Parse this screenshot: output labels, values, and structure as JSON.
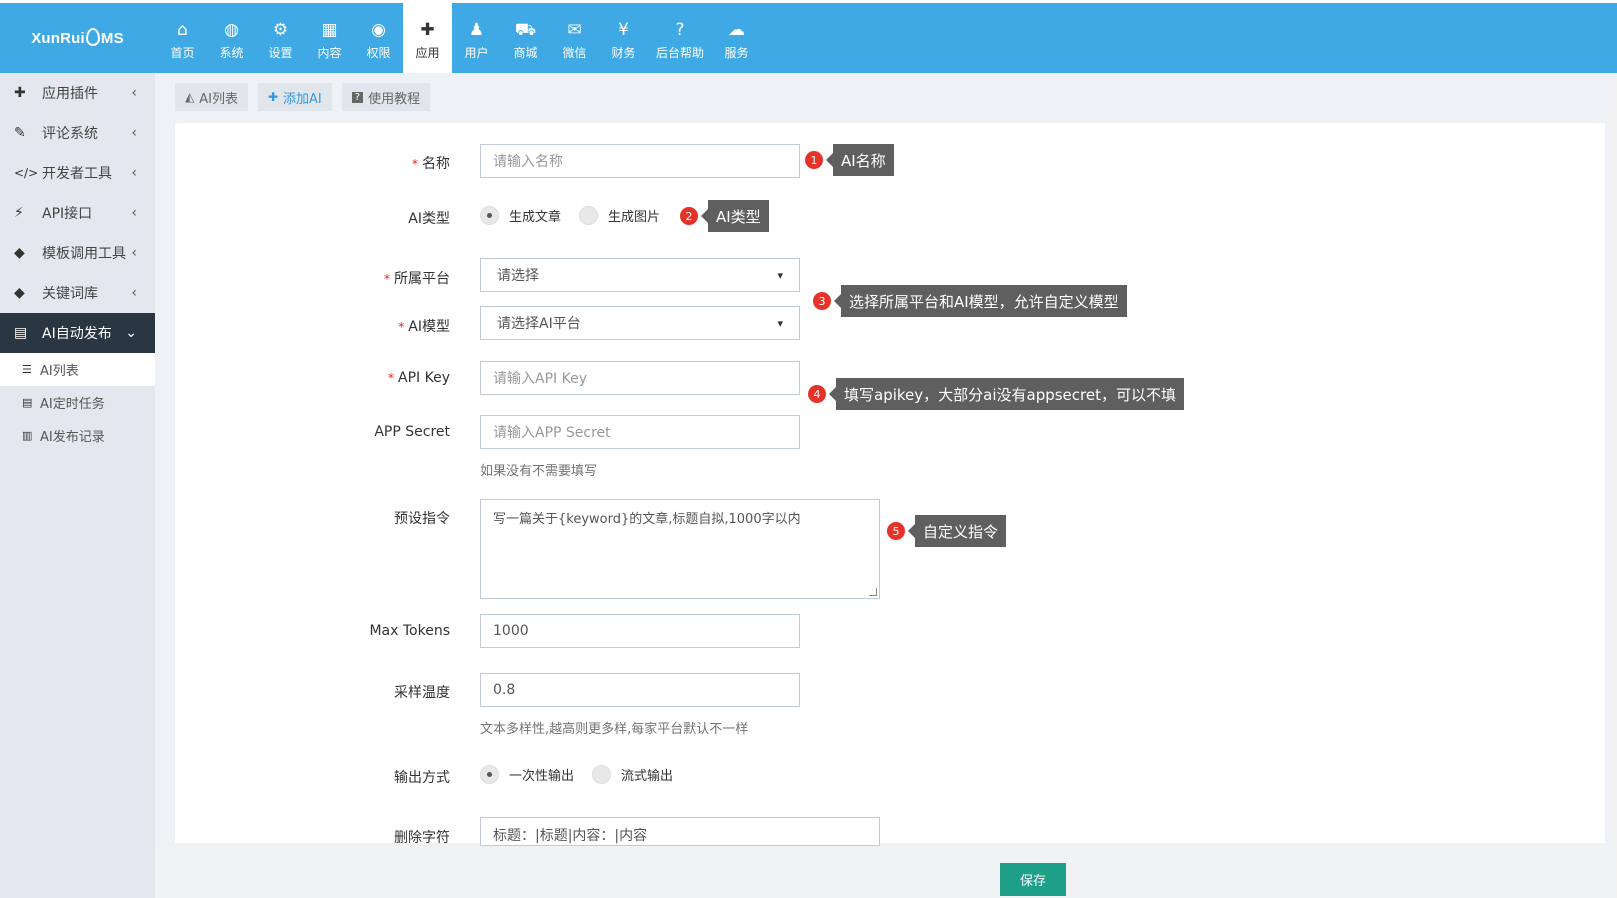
{
  "app": {
    "logo_text_left": "XunRui",
    "logo_text_right": "MS"
  },
  "nav": [
    {
      "label": "首页",
      "icon": "home-icon",
      "glyph": "⌂"
    },
    {
      "label": "系统",
      "icon": "globe-icon",
      "glyph": "◍"
    },
    {
      "label": "设置",
      "icon": "gears-icon",
      "glyph": "⚙"
    },
    {
      "label": "内容",
      "icon": "grid-icon",
      "glyph": "▦"
    },
    {
      "label": "权限",
      "icon": "user-circle-icon",
      "glyph": "◉"
    },
    {
      "label": "应用",
      "icon": "puzzle-icon",
      "glyph": "✚"
    },
    {
      "label": "用户",
      "icon": "user-icon",
      "glyph": "♟"
    },
    {
      "label": "商城",
      "icon": "cart-icon",
      "glyph": "⛟"
    },
    {
      "label": "微信",
      "icon": "wechat-icon",
      "glyph": "✉"
    },
    {
      "label": "财务",
      "icon": "yen-icon",
      "glyph": "¥"
    },
    {
      "label": "后台帮助",
      "icon": "help-icon",
      "glyph": "?"
    },
    {
      "label": "服务",
      "icon": "cloud-icon",
      "glyph": "☁"
    }
  ],
  "sidebar": {
    "items": [
      {
        "label": "应用插件",
        "icon": "puzzle-icon",
        "glyph": "✚"
      },
      {
        "label": "评论系统",
        "icon": "comments-icon",
        "glyph": "✎"
      },
      {
        "label": "开发者工具",
        "icon": "code-icon",
        "glyph": "</>"
      },
      {
        "label": "API接口",
        "icon": "plug-icon",
        "glyph": "⚡"
      },
      {
        "label": "模板调用工具",
        "icon": "tag-icon",
        "glyph": "◆"
      },
      {
        "label": "关键词库",
        "icon": "tags-icon",
        "glyph": "◆"
      },
      {
        "label": "AI自动发布",
        "icon": "list-alt-icon",
        "glyph": "▤"
      }
    ],
    "sub_items": [
      {
        "label": "AI列表",
        "icon": "list-icon",
        "glyph": "☰"
      },
      {
        "label": "AI定时任务",
        "icon": "tasks-icon",
        "glyph": "▤"
      },
      {
        "label": "AI发布记录",
        "icon": "bar-chart-icon",
        "glyph": "▥"
      }
    ]
  },
  "tabs": [
    {
      "label": "AI列表",
      "icon": "area-chart-icon",
      "glyph": "◭"
    },
    {
      "label": "添加AI",
      "icon": "plus-icon",
      "glyph": "✚"
    },
    {
      "label": "使用教程",
      "icon": "question-icon",
      "glyph": "?"
    }
  ],
  "form": {
    "name": {
      "label": "名称",
      "placeholder": "请输入名称"
    },
    "ai_type": {
      "label": "AI类型",
      "options": [
        "生成文章",
        "生成图片"
      ],
      "selected": "生成文章"
    },
    "platform": {
      "label": "所属平台",
      "value": "请选择"
    },
    "model": {
      "label": "AI模型",
      "value": "请选择AI平台"
    },
    "api_key": {
      "label": "API Key",
      "placeholder": "请输入API Key"
    },
    "app_secret": {
      "label": "APP Secret",
      "placeholder": "请输入APP Secret",
      "help": "如果没有不需要填写"
    },
    "prompt": {
      "label": "预设指令",
      "value": "写一篇关于{keyword}的文章,标题自拟,1000字以内"
    },
    "max_tokens": {
      "label": "Max Tokens",
      "value": "1000"
    },
    "temperature": {
      "label": "采样温度",
      "value": "0.8",
      "help": "文本多样性,越高则更多样,每家平台默认不一样"
    },
    "output": {
      "label": "输出方式",
      "options": [
        "一次性输出",
        "流式输出"
      ],
      "selected": "一次性输出"
    },
    "strip_chars": {
      "label": "删除字符",
      "value": "标题：|标题|内容：|内容"
    }
  },
  "annotations": [
    {
      "num": "1",
      "text": "AI名称"
    },
    {
      "num": "2",
      "text": "AI类型"
    },
    {
      "num": "3",
      "text": "选择所属平台和AI模型，允许自定义模型"
    },
    {
      "num": "4",
      "text": "填写apikey，大部分ai没有appsecret，可以不填"
    },
    {
      "num": "5",
      "text": "自定义指令"
    }
  ],
  "footer": {
    "save_label": "保存"
  },
  "colors": {
    "topbar": "#3fa9e6",
    "sidebar_active": "#2b3643",
    "save": "#1e9f88",
    "badge": "#e6332a"
  }
}
